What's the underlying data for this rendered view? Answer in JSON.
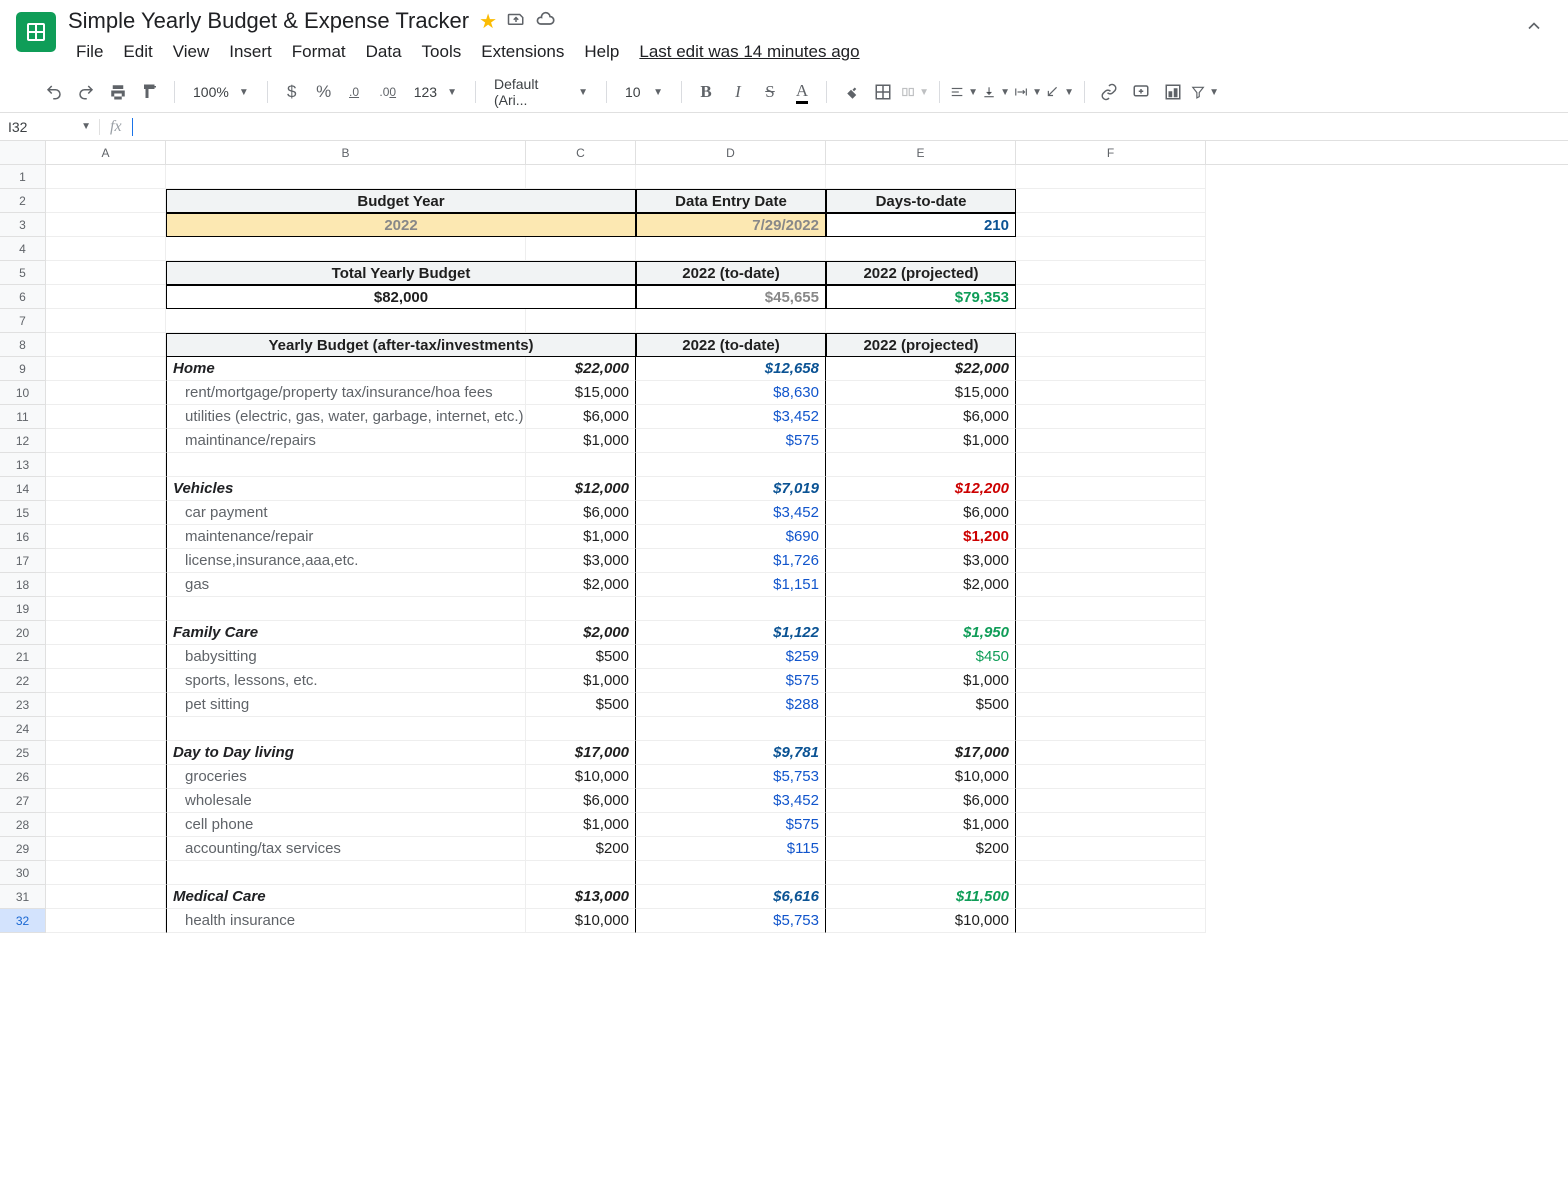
{
  "app": {
    "title": "Simple Yearly Budget & Expense Tracker",
    "last_edit": "Last edit was 14 minutes ago"
  },
  "menu": {
    "file": "File",
    "edit": "Edit",
    "view": "View",
    "insert": "Insert",
    "format": "Format",
    "data": "Data",
    "tools": "Tools",
    "extensions": "Extensions",
    "help": "Help"
  },
  "toolbar": {
    "zoom": "100%",
    "currency": "$",
    "percent": "%",
    "decdec": ".0",
    "incdec": ".00",
    "fmt123": "123",
    "font": "Default (Ari...",
    "fontsize": "10"
  },
  "namebox": "I32",
  "fx": "fx",
  "cols": [
    "A",
    "B",
    "C",
    "D",
    "E",
    "F"
  ],
  "rows": [
    "1",
    "2",
    "3",
    "4",
    "5",
    "6",
    "7",
    "8",
    "9",
    "10",
    "11",
    "12",
    "13",
    "14",
    "15",
    "16",
    "17",
    "18",
    "19",
    "20",
    "21",
    "22",
    "23",
    "24",
    "25",
    "26",
    "27",
    "28",
    "29",
    "30",
    "31",
    "32"
  ],
  "sheet": {
    "r2": {
      "bc": "Budget Year",
      "d": "Data Entry Date",
      "e": "Days-to-date"
    },
    "r3": {
      "bc": "2022",
      "d": "7/29/2022",
      "e": "210"
    },
    "r5": {
      "bc": "Total Yearly Budget",
      "d": "2022 (to-date)",
      "e": "2022 (projected)"
    },
    "r6": {
      "bc": "$82,000",
      "d": "$45,655",
      "e": "$79,353"
    },
    "r8": {
      "bc": "Yearly Budget (after-tax/investments)",
      "d": "2022 (to-date)",
      "e": "2022 (projected)"
    },
    "r9": {
      "b": "Home",
      "c": "$22,000",
      "d": "$12,658",
      "e": "$22,000"
    },
    "r10": {
      "b": "rent/mortgage/property tax/insurance/hoa fees",
      "c": "$15,000",
      "d": "$8,630",
      "e": "$15,000"
    },
    "r11": {
      "b": "utilities (electric, gas, water, garbage, internet, etc.)",
      "c": "$6,000",
      "d": "$3,452",
      "e": "$6,000"
    },
    "r12": {
      "b": "maintinance/repairs",
      "c": "$1,000",
      "d": "$575",
      "e": "$1,000"
    },
    "r14": {
      "b": "Vehicles",
      "c": "$12,000",
      "d": "$7,019",
      "e": "$12,200"
    },
    "r15": {
      "b": "car payment",
      "c": "$6,000",
      "d": "$3,452",
      "e": "$6,000"
    },
    "r16": {
      "b": "maintenance/repair",
      "c": "$1,000",
      "d": "$690",
      "e": "$1,200"
    },
    "r17": {
      "b": "license,insurance,aaa,etc.",
      "c": "$3,000",
      "d": "$1,726",
      "e": "$3,000"
    },
    "r18": {
      "b": "gas",
      "c": "$2,000",
      "d": "$1,151",
      "e": "$2,000"
    },
    "r20": {
      "b": "Family Care",
      "c": "$2,000",
      "d": "$1,122",
      "e": "$1,950"
    },
    "r21": {
      "b": "babysitting",
      "c": "$500",
      "d": "$259",
      "e": "$450"
    },
    "r22": {
      "b": "sports, lessons, etc.",
      "c": "$1,000",
      "d": "$575",
      "e": "$1,000"
    },
    "r23": {
      "b": "pet sitting",
      "c": "$500",
      "d": "$288",
      "e": "$500"
    },
    "r25": {
      "b": "Day to Day living",
      "c": "$17,000",
      "d": "$9,781",
      "e": "$17,000"
    },
    "r26": {
      "b": "groceries",
      "c": "$10,000",
      "d": "$5,753",
      "e": "$10,000"
    },
    "r27": {
      "b": "wholesale",
      "c": "$6,000",
      "d": "$3,452",
      "e": "$6,000"
    },
    "r28": {
      "b": "cell phone",
      "c": "$1,000",
      "d": "$575",
      "e": "$1,000"
    },
    "r29": {
      "b": "accounting/tax services",
      "c": "$200",
      "d": "$115",
      "e": "$200"
    },
    "r31": {
      "b": "Medical Care",
      "c": "$13,000",
      "d": "$6,616",
      "e": "$11,500"
    },
    "r32": {
      "b": "health insurance",
      "c": "$10,000",
      "d": "$5,753",
      "e": "$10,000"
    }
  }
}
